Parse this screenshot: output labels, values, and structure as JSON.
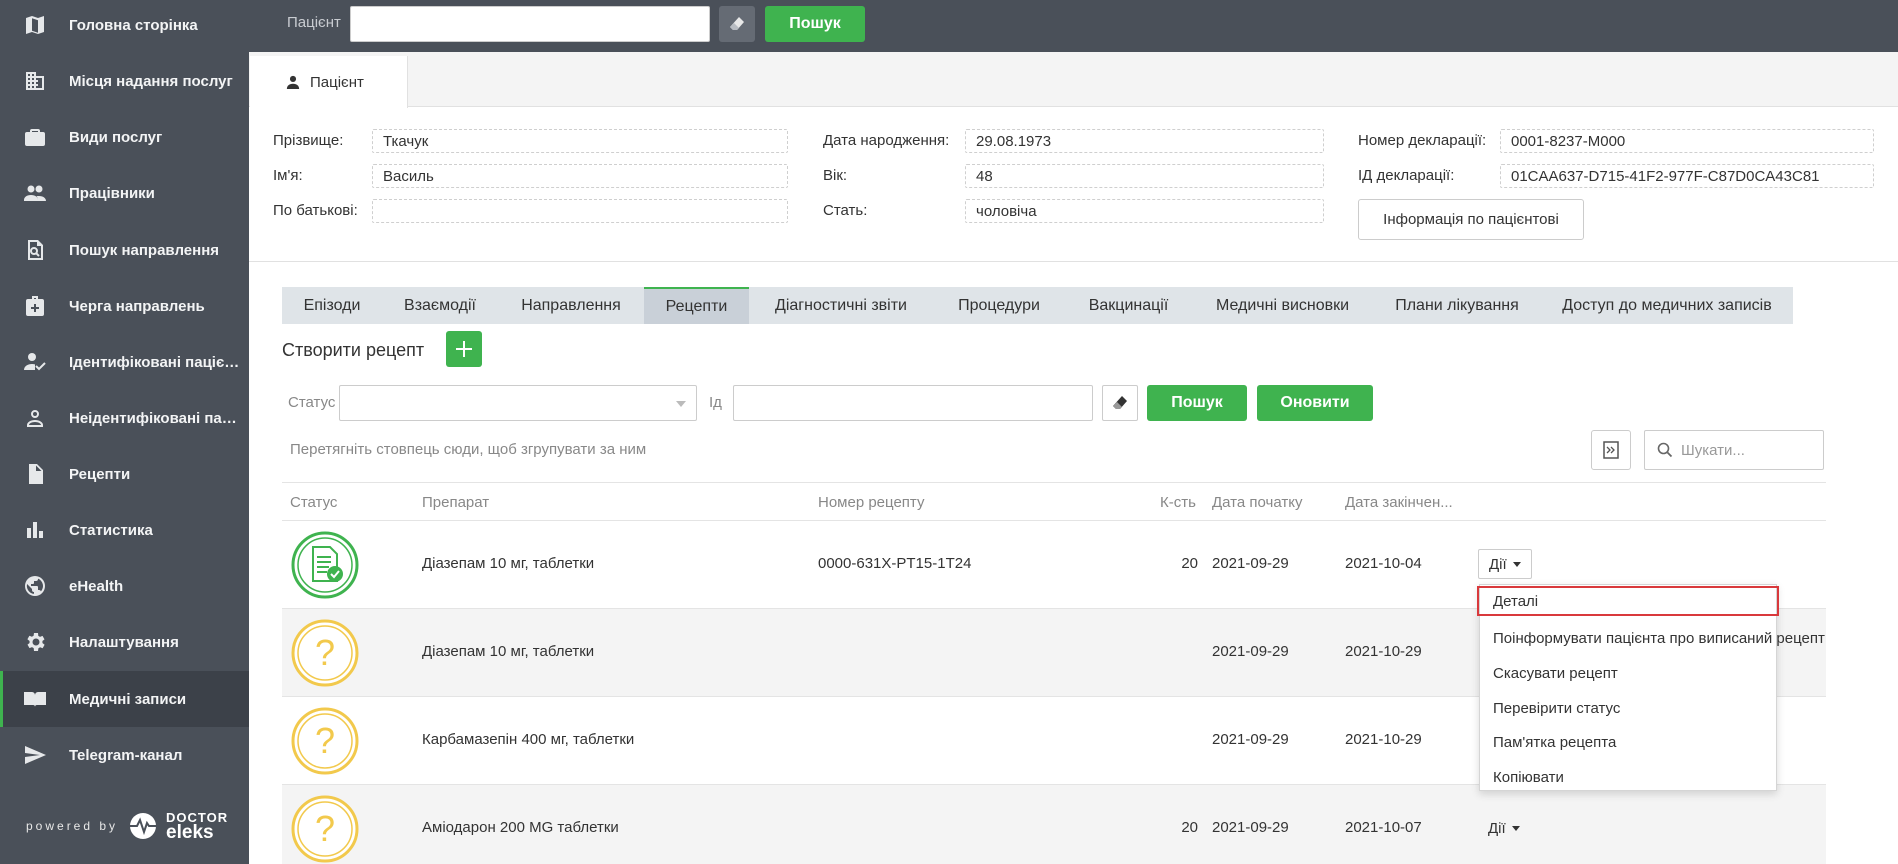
{
  "sidebar": {
    "items": [
      {
        "label": "Головна сторінка",
        "icon": "map-icon"
      },
      {
        "label": "Місця надання послуг",
        "icon": "building-icon"
      },
      {
        "label": "Види послуг",
        "icon": "briefcase-icon"
      },
      {
        "label": "Працівники",
        "icon": "people-icon"
      },
      {
        "label": "Пошук направлення",
        "icon": "document-search-icon"
      },
      {
        "label": "Черга направлень",
        "icon": "medical-bag-icon"
      },
      {
        "label": "Ідентифіковані пацієнти",
        "icon": "user-check-icon"
      },
      {
        "label": "Неідентифіковані паціє...",
        "icon": "user-outline-icon"
      },
      {
        "label": "Рецепти",
        "icon": "document-icon"
      },
      {
        "label": "Статистика",
        "icon": "bar-chart-icon"
      },
      {
        "label": "eHealth",
        "icon": "globe-icon"
      },
      {
        "label": "Налаштування",
        "icon": "gear-icon"
      },
      {
        "label": "Медичні записи",
        "icon": "open-book-icon",
        "active": true
      },
      {
        "label": "Telegram-канал",
        "icon": "send-icon"
      }
    ],
    "powered_by": "powered by",
    "logo_top": "DOCTOR",
    "logo_bottom": "eleks"
  },
  "topbar": {
    "patient_label": "Пацієнт",
    "patient_value": "",
    "search_label": "Пошук"
  },
  "patient_tab": {
    "label": "Пацієнт"
  },
  "patient": {
    "surname_label": "Прізвище:",
    "surname": "Ткачук",
    "name_label": "Ім'я:",
    "name": "Василь",
    "patronymic_label": "По батькові:",
    "patronymic": "",
    "birth_label": "Дата народження:",
    "birth": "29.08.1973",
    "age_label": "Вік:",
    "age": "48",
    "sex_label": "Стать:",
    "sex": "чоловіча",
    "decl_num_label": "Номер декларації:",
    "decl_num": "0001-8237-M000",
    "decl_id_label": "ІД декларації:",
    "decl_id": "01CAA637-D715-41F2-977F-C87D0CA43C81",
    "info_button": "Інформація по пацієнтові"
  },
  "section_tabs": [
    {
      "label": "Епізоди"
    },
    {
      "label": "Взаємодії"
    },
    {
      "label": "Направлення"
    },
    {
      "label": "Рецепти",
      "active": true
    },
    {
      "label": "Діагностичні звіти"
    },
    {
      "label": "Процедури"
    },
    {
      "label": "Вакцинації"
    },
    {
      "label": "Медичні висновки"
    },
    {
      "label": "Плани лікування"
    },
    {
      "label": "Доступ до медичних записів"
    }
  ],
  "create": {
    "label": "Створити рецепт"
  },
  "filters": {
    "status_label": "Статус",
    "status_value": "",
    "id_label": "Ід",
    "id_value": "",
    "search_button": "Пошук",
    "refresh_button": "Оновити"
  },
  "grid": {
    "group_hint": "Перетягніть стовпець сюди, щоб згрупувати за ним",
    "search_placeholder": "Шукати...",
    "columns": {
      "status": "Статус",
      "drug": "Препарат",
      "number": "Номер рецепту",
      "qty": "К-сть",
      "start": "Дата початку",
      "end": "Дата закінчен..."
    },
    "actions_label": "Дії",
    "rows": [
      {
        "status": "signed",
        "drug": "Діазепам 10 мг, таблетки",
        "number": "0000-631X-PT15-1T24",
        "qty": "20",
        "start": "2021-09-29",
        "end": "2021-10-04"
      },
      {
        "status": "unknown",
        "drug": "Діазепам 10 мг, таблетки",
        "number": "",
        "qty": "",
        "start": "2021-09-29",
        "end": "2021-10-29"
      },
      {
        "status": "unknown",
        "drug": "Карбамазепін 400 мг, таблетки",
        "number": "",
        "qty": "",
        "start": "2021-09-29",
        "end": "2021-10-29"
      },
      {
        "status": "unknown",
        "drug": "Аміодарон 200 MG таблетки",
        "number": "",
        "qty": "20",
        "start": "2021-09-29",
        "end": "2021-10-07"
      }
    ]
  },
  "menu": {
    "items": [
      {
        "label": "Деталі",
        "highlighted": true
      },
      {
        "label": "Поінформувати пацієнта про виписаний рецепт"
      },
      {
        "label": "Скасувати рецепт"
      },
      {
        "label": "Перевірити статус"
      },
      {
        "label": "Пам'ятка рецепта"
      },
      {
        "label": "Копіювати"
      }
    ]
  },
  "colors": {
    "sidebar_bg": "#4a5059",
    "accent_green": "#3fb34f",
    "status_signed": "#3fb34f",
    "status_unknown": "#f2c94c",
    "highlight_red": "#d9393c"
  }
}
